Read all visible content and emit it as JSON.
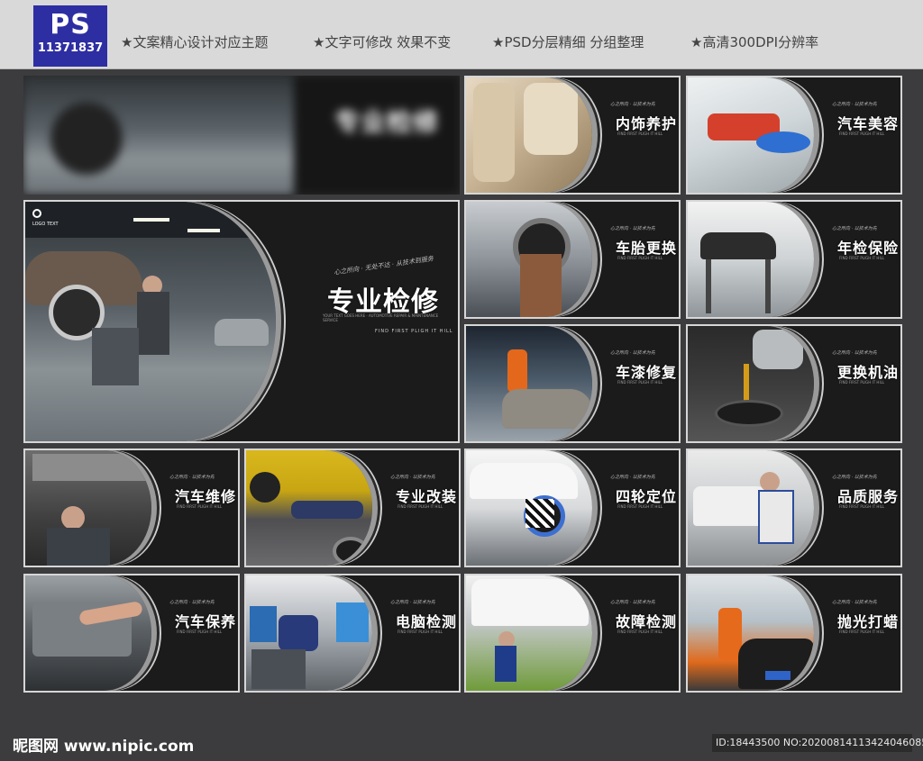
{
  "banner": {
    "ps_logo": "PS",
    "ps_id": "11371837",
    "features": [
      "★文案精心设计对应主题",
      "★文字可修改 效果不变",
      "★PSD分层精细 分组整理",
      "★高清300DPI分辨率"
    ]
  },
  "cover": {
    "blurred_title": "专业检修"
  },
  "hero": {
    "logo_text": "LOGO TEXT",
    "slogan": "心之所向 · 无处不达 · 从技术到服务",
    "title": "专业检修",
    "subtitle": "FIND FIRST PLIGH IT HILL",
    "body": "YOUR TEXT GOES HERE · AUTOMOTIVE REPAIR & MAINTENANCE SERVICE"
  },
  "cards": [
    {
      "title": "内饰养护"
    },
    {
      "title": "汽车美容"
    },
    {
      "title": "车胎更换"
    },
    {
      "title": "年检保险"
    },
    {
      "title": "车漆修复"
    },
    {
      "title": "更换机油"
    },
    {
      "title": "汽车维修"
    },
    {
      "title": "专业改装"
    },
    {
      "title": "四轮定位"
    },
    {
      "title": "品质服务"
    },
    {
      "title": "汽车保养"
    },
    {
      "title": "电脑检测"
    },
    {
      "title": "故障检测"
    },
    {
      "title": "抛光打蜡"
    }
  ],
  "card_slogan": "心之所向 · 以技术为先",
  "card_sub": "FIND FIRST PLIGH IT HILL",
  "footer": {
    "site": "昵图网 www.nipic.com",
    "id_text": "ID:18443500 NO:20200814113424046085"
  }
}
